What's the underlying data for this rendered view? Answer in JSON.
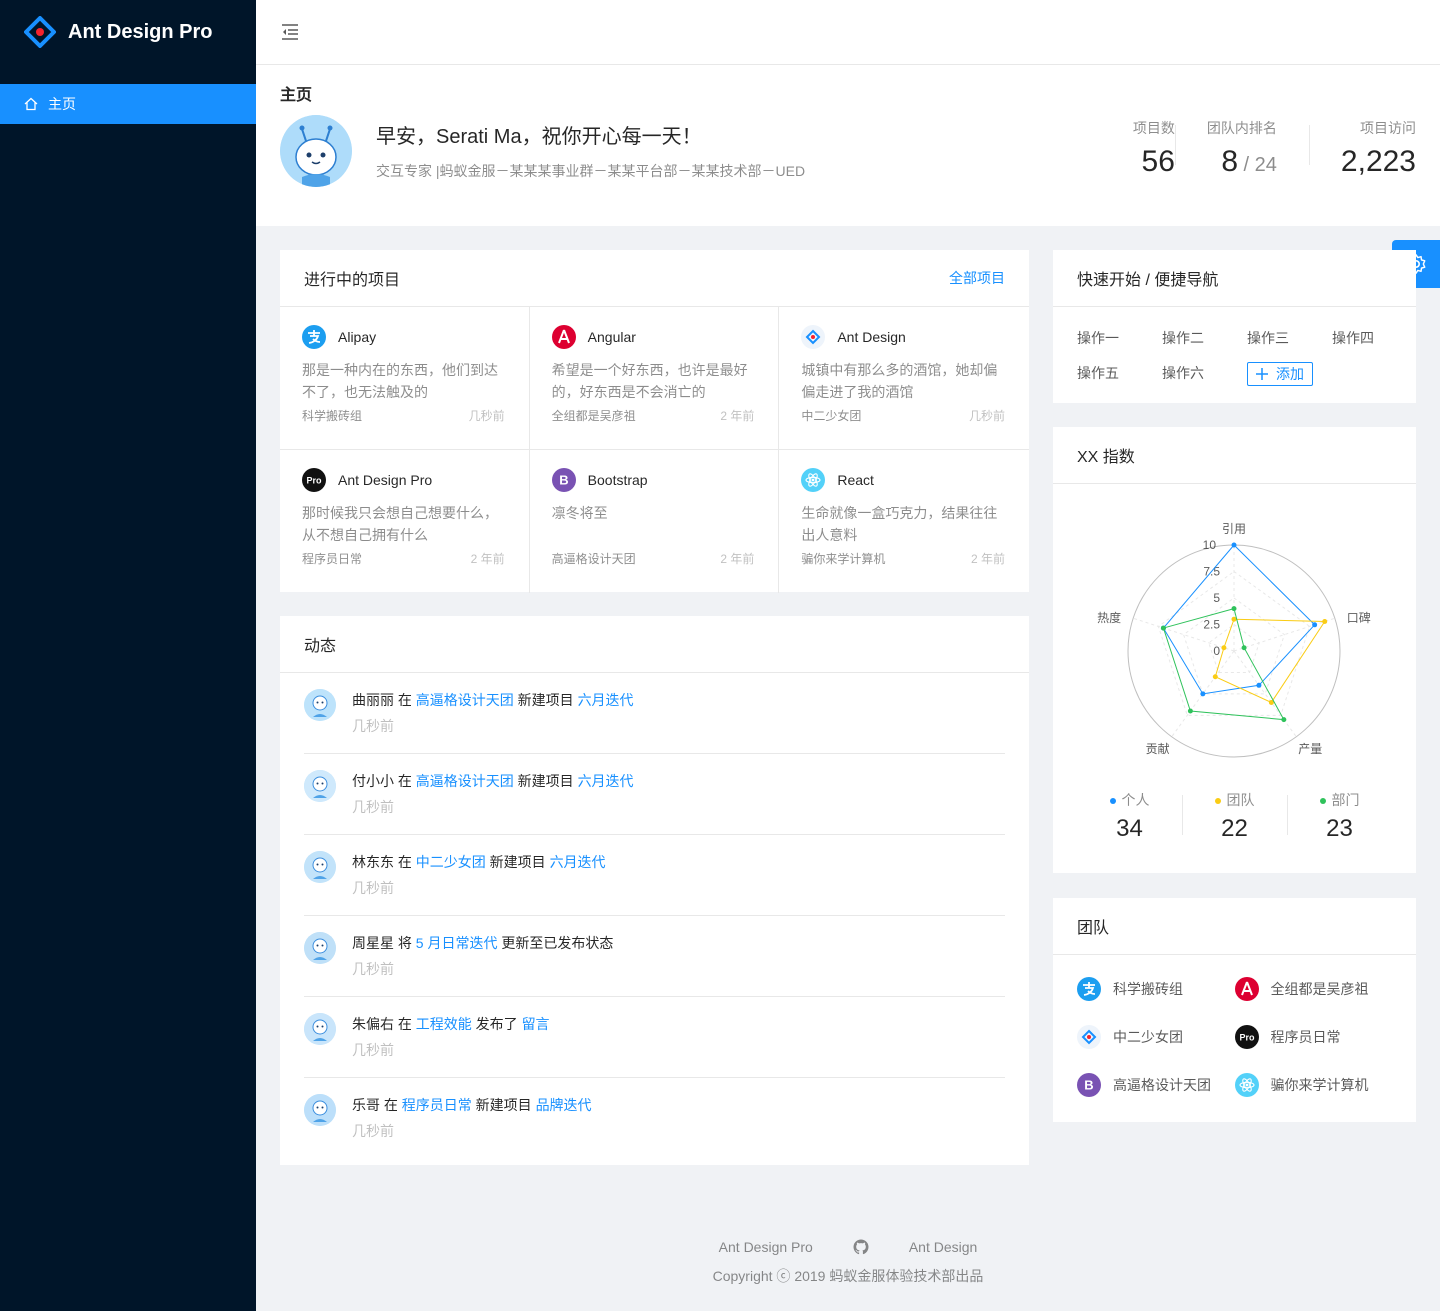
{
  "app": {
    "title": "Ant Design Pro"
  },
  "sidebar": {
    "items": [
      {
        "label": "主页",
        "icon": "home-icon"
      }
    ]
  },
  "page": {
    "title": "主页",
    "greeting": "早安，Serati Ma，祝你开心每一天！",
    "description": "交互专家 |蚂蚁金服－某某某事业群－某某平台部－某某技术部－UED",
    "stats": [
      {
        "label": "项目数",
        "value": "56"
      },
      {
        "label": "团队内排名",
        "value": "8",
        "sub": " / 24"
      },
      {
        "label": "项目访问",
        "value": "2,223"
      }
    ]
  },
  "projects": {
    "title": "进行中的项目",
    "all_link": "全部项目",
    "items": [
      {
        "name": "Alipay",
        "icon": "alipay-icon",
        "desc": "那是一种内在的东西，他们到达不了，也无法触及的",
        "group": "科学搬砖组",
        "time": "几秒前"
      },
      {
        "name": "Angular",
        "icon": "angular-icon",
        "desc": "希望是一个好东西，也许是最好的，好东西是不会消亡的",
        "group": "全组都是吴彦祖",
        "time": "2 年前"
      },
      {
        "name": "Ant Design",
        "icon": "ant-design-icon",
        "desc": "城镇中有那么多的酒馆，她却偏偏走进了我的酒馆",
        "group": "中二少女团",
        "time": "几秒前"
      },
      {
        "name": "Ant Design Pro",
        "icon": "ant-design-pro-icon",
        "desc": "那时候我只会想自己想要什么，从不想自己拥有什么",
        "group": "程序员日常",
        "time": "2 年前"
      },
      {
        "name": "Bootstrap",
        "icon": "bootstrap-icon",
        "desc": "凛冬将至",
        "group": "高逼格设计天团",
        "time": "2 年前"
      },
      {
        "name": "React",
        "icon": "react-icon",
        "desc": "生命就像一盒巧克力，结果往往出人意料",
        "group": "骗你来学计算机",
        "time": "2 年前"
      }
    ]
  },
  "activities": {
    "title": "动态",
    "items": [
      {
        "user": "曲丽丽",
        "verb1": " 在 ",
        "link1": "高逼格设计天团",
        "verb2": " 新建项目 ",
        "link2": "六月迭代",
        "tail": "",
        "time": "几秒前"
      },
      {
        "user": "付小小",
        "verb1": " 在 ",
        "link1": "高逼格设计天团",
        "verb2": " 新建项目 ",
        "link2": "六月迭代",
        "tail": "",
        "time": "几秒前"
      },
      {
        "user": "林东东",
        "verb1": " 在 ",
        "link1": "中二少女团",
        "verb2": " 新建项目 ",
        "link2": "六月迭代",
        "tail": "",
        "time": "几秒前"
      },
      {
        "user": "周星星",
        "verb1": " 将 ",
        "link1": "5 月日常迭代",
        "verb2": " 更新至已发布状态",
        "link2": "",
        "tail": "",
        "time": "几秒前"
      },
      {
        "user": "朱偏右",
        "verb1": " 在 ",
        "link1": "工程效能",
        "verb2": " 发布了 ",
        "link2": "留言",
        "tail": "",
        "time": "几秒前"
      },
      {
        "user": "乐哥",
        "verb1": " 在 ",
        "link1": "程序员日常",
        "verb2": " 新建项目 ",
        "link2": "品牌迭代",
        "tail": "",
        "time": "几秒前"
      }
    ]
  },
  "quick_links": {
    "title": "快速开始 / 便捷导航",
    "items": [
      "操作一",
      "操作二",
      "操作三",
      "操作四",
      "操作五",
      "操作六"
    ],
    "add_label": "添加"
  },
  "radar": {
    "title": "XX 指数",
    "legend": [
      {
        "name": "个人",
        "value": "34",
        "color": "#1890ff"
      },
      {
        "name": "团队",
        "value": "22",
        "color": "#facc14"
      },
      {
        "name": "部门",
        "value": "23",
        "color": "#2fc25b"
      }
    ]
  },
  "chart_data": {
    "type": "radar",
    "title": "",
    "axes": [
      "引用",
      "口碑",
      "产量",
      "贡献",
      "热度"
    ],
    "ticks": [
      "0",
      "2.5",
      "5",
      "7.5",
      "10"
    ],
    "range": [
      0,
      10
    ],
    "series": [
      {
        "name": "个人",
        "values": [
          10,
          8,
          4,
          5,
          7
        ],
        "color": "#1890ff"
      },
      {
        "name": "团队",
        "values": [
          3,
          9,
          6,
          3,
          1
        ],
        "color": "#facc14"
      },
      {
        "name": "部门",
        "values": [
          4,
          1,
          8,
          7,
          7
        ],
        "color": "#2fc25b"
      }
    ]
  },
  "team": {
    "title": "团队",
    "items": [
      {
        "name": "科学搬砖组",
        "icon": "alipay-icon"
      },
      {
        "name": "全组都是吴彦祖",
        "icon": "angular-icon"
      },
      {
        "name": "中二少女团",
        "icon": "ant-design-icon"
      },
      {
        "name": "程序员日常",
        "icon": "ant-design-pro-icon"
      },
      {
        "name": "高逼格设计天团",
        "icon": "bootstrap-icon"
      },
      {
        "name": "骗你来学计算机",
        "icon": "react-icon"
      }
    ]
  },
  "footer": {
    "links": [
      "Ant Design Pro",
      "Ant Design"
    ],
    "copyright": "Copyright ⓒ 2019 蚂蚁金服体验技术部出品"
  }
}
